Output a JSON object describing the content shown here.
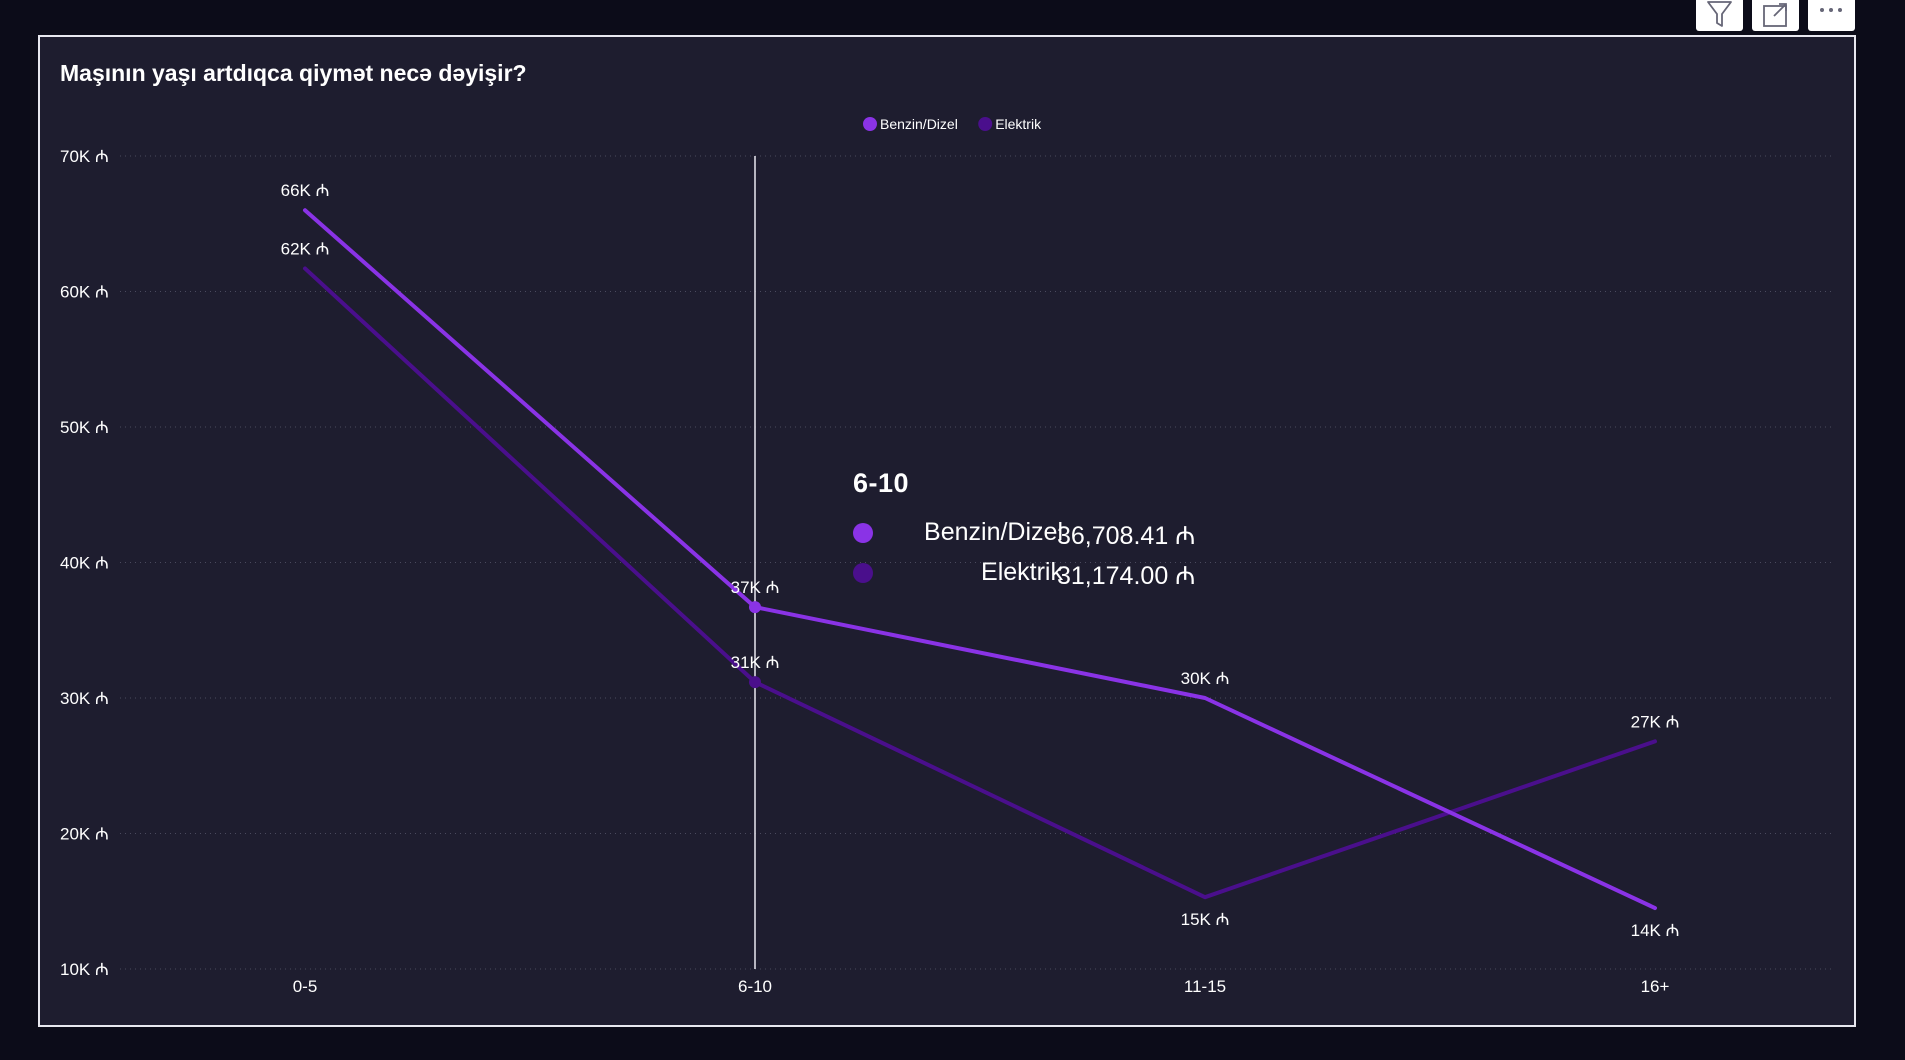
{
  "visual": {
    "title": "Maşının yaşı artdıqca qiymət necə dəyişir?",
    "header_buttons": [
      {
        "icon": "filter-icon"
      },
      {
        "icon": "focus-mode-icon"
      },
      {
        "icon": "more-options-icon"
      }
    ]
  },
  "colors": {
    "page_background": "#0c0c19",
    "visual_background": "#1e1d2f",
    "benzin_dizel": "#8a33e6",
    "elektrik": "#4a0f8c",
    "text": "#ffffff",
    "gridline": "#4a4a5e"
  },
  "chart_data": {
    "type": "line",
    "title": "Maşının yaşı artdıqca qiymət necə dəyişir?",
    "xlabel": "",
    "ylabel": "",
    "categories": [
      "0-5",
      "6-10",
      "11-15",
      "16+"
    ],
    "ylim": [
      10000,
      70000
    ],
    "y_ticks": [
      {
        "value": 10000,
        "label": "10K ₼"
      },
      {
        "value": 20000,
        "label": "20K ₼"
      },
      {
        "value": 30000,
        "label": "30K ₼"
      },
      {
        "value": 40000,
        "label": "40K ₼"
      },
      {
        "value": 50000,
        "label": "50K ₼"
      },
      {
        "value": 60000,
        "label": "60K ₼"
      },
      {
        "value": 70000,
        "label": "70K ₼"
      }
    ],
    "grid": true,
    "legend_position": "top-center",
    "series": [
      {
        "name": "Benzin/Dizel",
        "color": "#8a33e6",
        "values": [
          66000,
          36708.41,
          30000,
          14500
        ],
        "labels": [
          "66K ₼",
          "37K ₼",
          "30K ₼",
          "14K ₼"
        ],
        "label_placement": [
          "above",
          "above",
          "above",
          "below"
        ]
      },
      {
        "name": "Elektrik",
        "color": "#4a0f8c",
        "values": [
          61700,
          31174.0,
          15300,
          26800
        ],
        "labels": [
          "62K ₼",
          "31K ₼",
          "15K ₼",
          "27K ₼"
        ],
        "label_placement": [
          "above",
          "above",
          "below",
          "above"
        ]
      }
    ],
    "hover": {
      "category": "6-10",
      "rows": [
        {
          "name": "Benzin/Dizel",
          "value": "36,708.41 ₼",
          "color": "#8a33e6"
        },
        {
          "name": "Elektrik",
          "value": "31,174.00 ₼",
          "color": "#4a0f8c"
        }
      ]
    }
  }
}
